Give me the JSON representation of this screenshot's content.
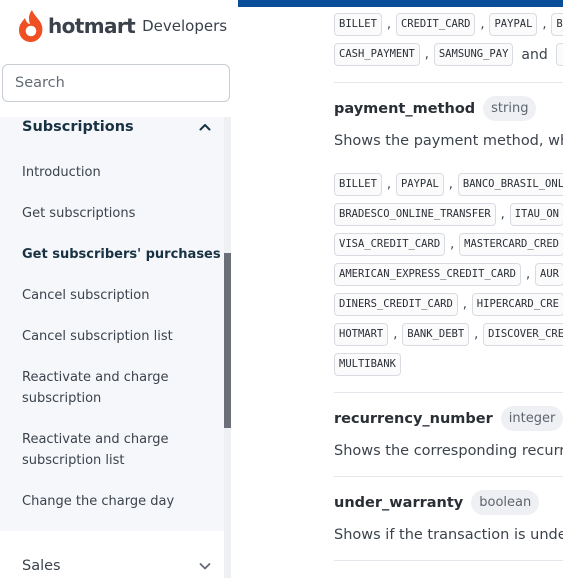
{
  "brand": {
    "logo_text": "hotmart",
    "subtitle": "Developers",
    "color": "#f04e23"
  },
  "search": {
    "placeholder": "Search",
    "value": ""
  },
  "sidebar": {
    "section": {
      "title": "Subscriptions",
      "expanded": true,
      "items": [
        {
          "label": "Introduction",
          "active": false
        },
        {
          "label": "Get subscriptions",
          "active": false
        },
        {
          "label": "Get subscribers' purchases",
          "active": true
        },
        {
          "label": "Cancel subscription",
          "active": false
        },
        {
          "label": "Cancel subscription list",
          "active": false
        },
        {
          "label": "Reactivate and charge subscription",
          "active": false
        },
        {
          "label": "Reactivate and charge subscription list",
          "active": false
        },
        {
          "label": "Change the charge day",
          "active": false
        }
      ]
    },
    "next_section": {
      "title": "Sales",
      "expanded": false
    }
  },
  "content": {
    "payment_type_values": {
      "line1": [
        "BILLET",
        "CREDIT_CARD",
        "PAYPAL",
        "B"
      ],
      "line2": [
        "CASH_PAYMENT",
        "SAMSUNG_PAY"
      ],
      "conjunction": "and"
    },
    "fields": [
      {
        "name": "payment_method",
        "type": "string",
        "description": "Shows the payment method, whi",
        "values": [
          [
            "BILLET",
            "PAYPAL",
            "BANCO_BRASIL_ONL"
          ],
          [
            "BRADESCO_ONLINE_TRANSFER",
            "ITAU_ON"
          ],
          [
            "VISA_CREDIT_CARD",
            "MASTERCARD_CRED"
          ],
          [
            "AMERICAN_EXPRESS_CREDIT_CARD",
            "AUR"
          ],
          [
            "DINERS_CREDIT_CARD",
            "HIPERCARD_CRE"
          ],
          [
            "HOTMART",
            "BANK_DEBT",
            "DISCOVER_CRE"
          ],
          [
            "MULTIBANK"
          ]
        ]
      },
      {
        "name": "recurrency_number",
        "type": "integer",
        "description": "Shows the corresponding recurre"
      },
      {
        "name": "under_warranty",
        "type": "boolean",
        "description": "Shows if the transaction is under"
      }
    ]
  },
  "colors": {
    "accent_blue": "#0a4d99",
    "active_nav": "#183244",
    "panel_bg": "#f5f7fa"
  }
}
